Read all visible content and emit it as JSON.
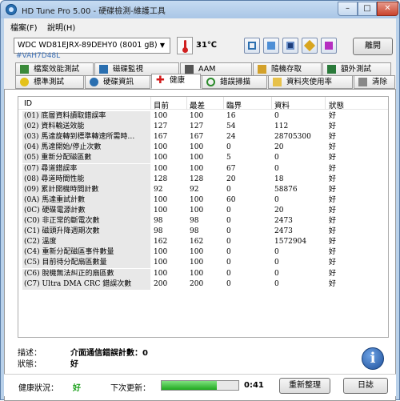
{
  "window": {
    "title": "HD Tune Pro  5.00 - 硬碟檢測-維護工具"
  },
  "menu": [
    {
      "label": "檔案(F)"
    },
    {
      "label": "說明(H)"
    }
  ],
  "toolbar": {
    "drive": "WDC WD81EJRX-89DEHY0 (8001 gB)",
    "firmware": "#VAH7D48L",
    "temperature": "31℃",
    "exit_label": "離開"
  },
  "tabs": [
    {
      "label": "檔案效能測試"
    },
    {
      "label": "磁碟監視"
    },
    {
      "label": "AAM"
    },
    {
      "label": "隨機存取"
    },
    {
      "label": "額外測試"
    },
    {
      "label": "標準測試"
    },
    {
      "label": "硬碟資訊"
    },
    {
      "label": "健康"
    },
    {
      "label": "錯誤掃描"
    },
    {
      "label": "資料夾使用率"
    },
    {
      "label": "清除"
    }
  ],
  "table": {
    "headers": [
      "ID",
      "目前",
      "最差",
      "臨界",
      "資料",
      "狀態"
    ],
    "rows": [
      [
        "(01) 底層資料讀取錯誤率",
        "100",
        "100",
        "16",
        "0",
        "好"
      ],
      [
        "(02) 資料輸送效能",
        "127",
        "127",
        "54",
        "112",
        "好"
      ],
      [
        "(03) 馬達旋轉到標準轉速所需時…",
        "167",
        "167",
        "24",
        "28705300",
        "好"
      ],
      [
        "(04) 馬達開始/停止次數",
        "100",
        "100",
        "0",
        "20",
        "好"
      ],
      [
        "(05) 重新分配磁區數",
        "100",
        "100",
        "5",
        "0",
        "好"
      ],
      [
        "(07) 尋道錯誤率",
        "100",
        "100",
        "67",
        "0",
        "好"
      ],
      [
        "(08) 尋道時間性能",
        "128",
        "128",
        "20",
        "18",
        "好"
      ],
      [
        "(09) 累計開機時間計數",
        "92",
        "92",
        "0",
        "58876",
        "好"
      ],
      [
        "(0A) 馬達重試計數",
        "100",
        "100",
        "60",
        "0",
        "好"
      ],
      [
        "(0C) 硬碟電源計數",
        "100",
        "100",
        "0",
        "20",
        "好"
      ],
      [
        "(C0) 非正常的斷電次數",
        "98",
        "98",
        "0",
        "2473",
        "好"
      ],
      [
        "(C1) 磁頭升降週期次數",
        "98",
        "98",
        "0",
        "2473",
        "好"
      ],
      [
        "(C2) 溫度",
        "162",
        "162",
        "0",
        "1572904",
        "好"
      ],
      [
        "(C4) 重新分配磁區事件數量",
        "100",
        "100",
        "0",
        "0",
        "好"
      ],
      [
        "(C5) 目前待分配扇區數量",
        "100",
        "100",
        "0",
        "0",
        "好"
      ],
      [
        "(C6) 脫機無法糾正的扇區數",
        "100",
        "100",
        "0",
        "0",
        "好"
      ],
      [
        "(C7) Ultra DMA CRC 錯誤次數",
        "200",
        "200",
        "0",
        "0",
        "好"
      ]
    ]
  },
  "description": {
    "label": "描述：",
    "value": "介面通信錯誤計數：0",
    "status_label": "狀態：",
    "status_value": "好"
  },
  "status_bar": {
    "health_label": "健康狀況：",
    "health_value": "好",
    "next_update_label": "下次更新：",
    "progress": 0.72,
    "time": "0:41",
    "refresh_label": "重新整理",
    "log_label": "日誌"
  },
  "colors": {
    "health": "#1aa01a",
    "accent": "#1d4f9a"
  }
}
